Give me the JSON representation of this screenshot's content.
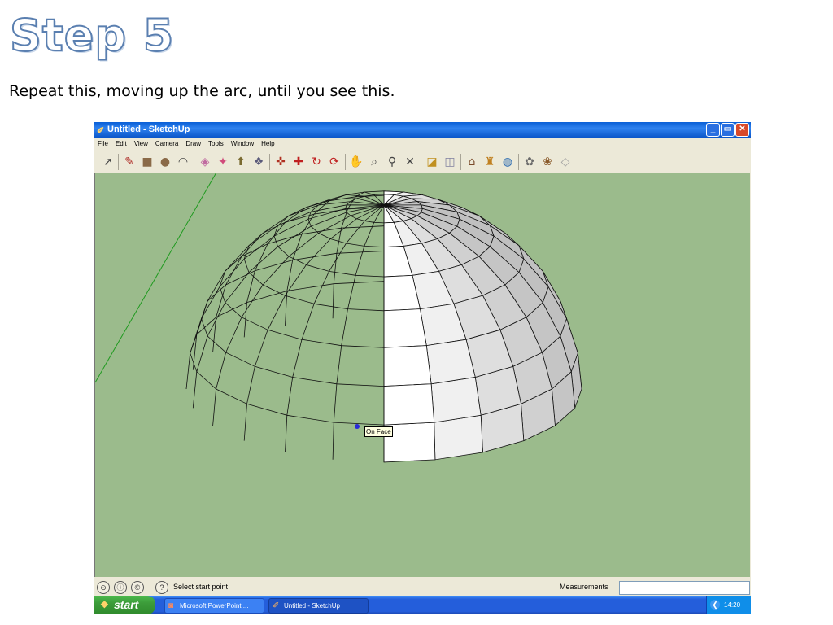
{
  "slide": {
    "title": "Step 5",
    "subtitle": "Repeat this, moving up the arc, until you see this."
  },
  "window": {
    "title": "Untitled - SketchUp",
    "buttons": {
      "minimize": "_",
      "maximize": "▭",
      "close": "✕"
    }
  },
  "menu": [
    "File",
    "Edit",
    "View",
    "Camera",
    "Draw",
    "Tools",
    "Window",
    "Help"
  ],
  "toolbar": {
    "tools": [
      "select-icon",
      "pencil-icon",
      "rectangle-icon",
      "circle-icon",
      "arc-icon",
      "eraser-icon",
      "paint-bucket-icon",
      "push-pull-icon",
      "follow-me-icon",
      "move-icon",
      "rotate-icon",
      "orbit-icon",
      "pan-icon",
      "zoom-icon",
      "zoom-extents-icon",
      "component-icon",
      "section-icon",
      "camera-icon",
      "walk-icon",
      "globe-icon",
      "warehouse-icon",
      "export-icon",
      "cube-icon"
    ]
  },
  "viewport": {
    "tooltip": "On Face",
    "bg_color": "#9bbb8c",
    "face_color": "#9fa3bf"
  },
  "status": {
    "hint": "Select start point",
    "measurements_label": "Measurements",
    "measurements_value": ""
  },
  "taskbar": {
    "start_label": "start",
    "tasks": [
      {
        "label": "Microsoft PowerPoint ...",
        "icon": "powerpoint-icon"
      },
      {
        "label": "Untitled - SketchUp",
        "icon": "sketchup-icon"
      }
    ],
    "clock": "14:20"
  }
}
